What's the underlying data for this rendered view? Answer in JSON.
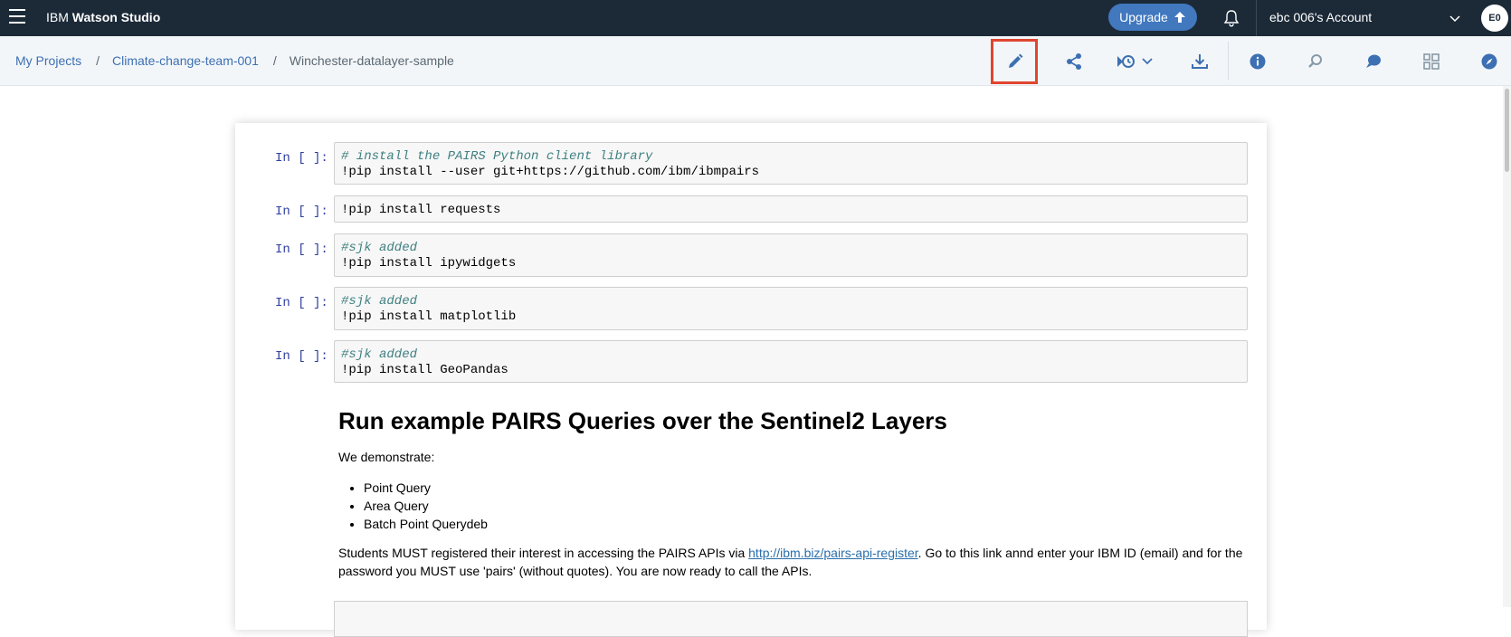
{
  "topbar": {
    "brand_prefix": "IBM",
    "brand_name": "Watson Studio",
    "upgrade_label": "Upgrade",
    "account_label": "ebc 006's Account",
    "avatar_initials": "E0",
    "bg_color": "#1c2a38",
    "upgrade_color": "#4178be"
  },
  "breadcrumb": {
    "items": [
      "My Projects",
      "Climate-change-team-001"
    ],
    "separator": "/",
    "current": "Winchester-datalayer-sample"
  },
  "toolbar": {
    "icons": [
      "edit-icon",
      "share-icon",
      "version-history-icon",
      "download-icon",
      "info-icon",
      "find-replace-icon",
      "comments-icon",
      "data-assets-icon",
      "explore-icon"
    ],
    "highlight_color": "#e0452f"
  },
  "notebook": {
    "prompt": "In [ ]:",
    "cells": [
      {
        "comment": "# install the PAIRS Python client library",
        "code": "!pip install --user git+https://github.com/ibm/ibmpairs"
      },
      {
        "comment": "",
        "code": "!pip install requests"
      },
      {
        "comment": "#sjk added",
        "code": "!pip install ipywidgets"
      },
      {
        "comment": "#sjk added",
        "code": "!pip install matplotlib"
      },
      {
        "comment": "#sjk added",
        "code": "!pip install GeoPandas"
      }
    ],
    "markdown": {
      "heading": "Run example PAIRS Queries over the Sentinel2 Layers",
      "intro": "We demonstrate:",
      "bullets": [
        "Point Query",
        "Area Query",
        "Batch Point Querydeb"
      ],
      "para_before_link": "Students MUST registered their interest in accessing the PAIRS APIs via ",
      "link": "http://ibm.biz/pairs-api-register",
      "para_after_link": ". Go to this link annd enter your IBM ID (email) and for the password you MUST use 'pairs' (without quotes). You are now ready to call the APIs."
    }
  }
}
